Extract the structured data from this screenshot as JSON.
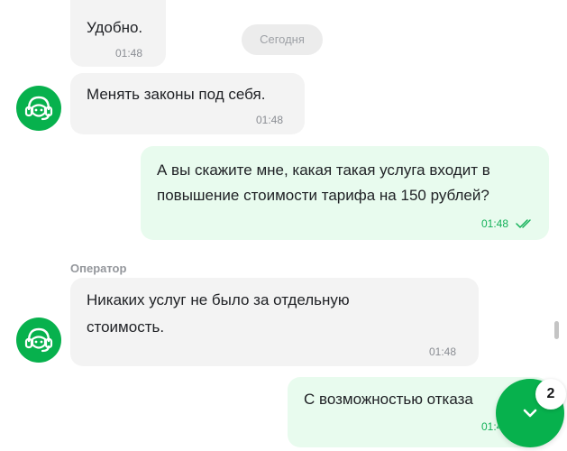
{
  "date_divider": "Сегодня",
  "messages": [
    {
      "text": "Удобно.",
      "time": "01:48"
    },
    {
      "text": "Менять законы под себя.",
      "time": "01:48"
    },
    {
      "line1": "А вы скажите мне, какая такая услуга входит в",
      "line2": "повышение стоимости тарифа на 150 рублей?",
      "time": "01:48"
    },
    {
      "sender": "Оператор",
      "line1": "Никаких услуг не было за отдельную",
      "line2": "стоимость.",
      "time": "01:48"
    },
    {
      "text": "С возможностью отказа",
      "time": "01:48"
    }
  ],
  "scroll_button": {
    "icon": "chevron-down-icon",
    "unread_count": "2"
  },
  "colors": {
    "accent": "#07b14d",
    "outgoing_bubble": "#e8fbee",
    "incoming_bubble": "#f3f3f3"
  }
}
